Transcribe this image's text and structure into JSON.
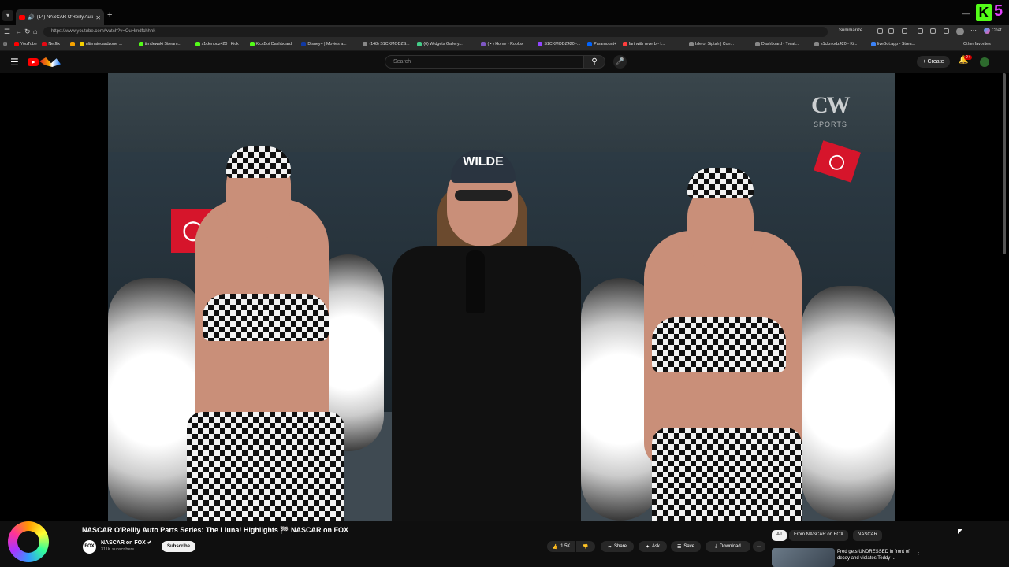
{
  "browser": {
    "tab": {
      "title": "(14) NASCAR O'Reilly Auto Pa",
      "icon": "youtube-favicon"
    },
    "url": "https://www.youtube.com/watch?v=OuHmdfchhhk",
    "summarize_label": "Summarize",
    "copilot_label": "Chat",
    "bookmarks": [
      {
        "label": "YouTube",
        "color": "#ff0000"
      },
      {
        "label": "Netflix",
        "color": "#e50914"
      },
      {
        "label": "",
        "color": "#f6a200"
      },
      {
        "label": "ultimatecardzone ...",
        "color": "#f5d000"
      },
      {
        "label": "timdewski Stream...",
        "color": "#53fc18"
      },
      {
        "label": "s1ckmodz420 | Kick",
        "color": "#53fc18"
      },
      {
        "label": "KickBot Dashboard",
        "color": "#53fc18"
      },
      {
        "label": "Disney+ | Movies a...",
        "color": "#1139a4"
      },
      {
        "label": "(148) S1CKMODZS...",
        "color": "#888888"
      },
      {
        "label": "(6) Widgets Gallery...",
        "color": "#44cc88"
      },
      {
        "label": "( • ) Home - Roblox",
        "color": "#7e57c2"
      },
      {
        "label": "S1CKMODZ420 -...",
        "color": "#9146ff"
      },
      {
        "label": "Paramount+",
        "color": "#0064ff"
      },
      {
        "label": "fart with reverb - I...",
        "color": "#ff3d3d"
      },
      {
        "label": "Isle of Siptah | Con...",
        "color": "#888888"
      },
      {
        "label": "Dashboard - Treat...",
        "color": "#888888"
      },
      {
        "label": "s1ckmodz420 - Ki...",
        "color": "#888888"
      },
      {
        "label": "liveBot.app - Strea...",
        "color": "#3b82f6"
      }
    ],
    "other_favorites": "Other favorites"
  },
  "youtube": {
    "search_placeholder": "Search",
    "create_label": "Create",
    "notif_count": "9+",
    "video": {
      "title": "NASCAR O'Reilly Auto Parts Series: The Liuna! Highlights 🏁 NASCAR on FOX",
      "channel": "NASCAR on FOX",
      "channel_abbrev": "FOX",
      "subscribers": "311K subscribers",
      "subscribe_label": "Subscribe",
      "likes": "1.5K",
      "share_label": "Share",
      "ask_label": "Ask",
      "save_label": "Save",
      "download_label": "Download",
      "watermark": "CW",
      "watermark_sub": "SPORTS",
      "cap_text": "WILDE"
    },
    "chips": [
      "All",
      "From NASCAR on FOX",
      "NASCAR"
    ],
    "recommendation": {
      "title": "Pred gets UNDRESSED in front of decoy and violates Teddy ..."
    }
  },
  "overlay": {
    "kick_letter": "K",
    "kick_number": "5",
    "kick_color": "#53fc18",
    "number_color": "#e040fb"
  }
}
